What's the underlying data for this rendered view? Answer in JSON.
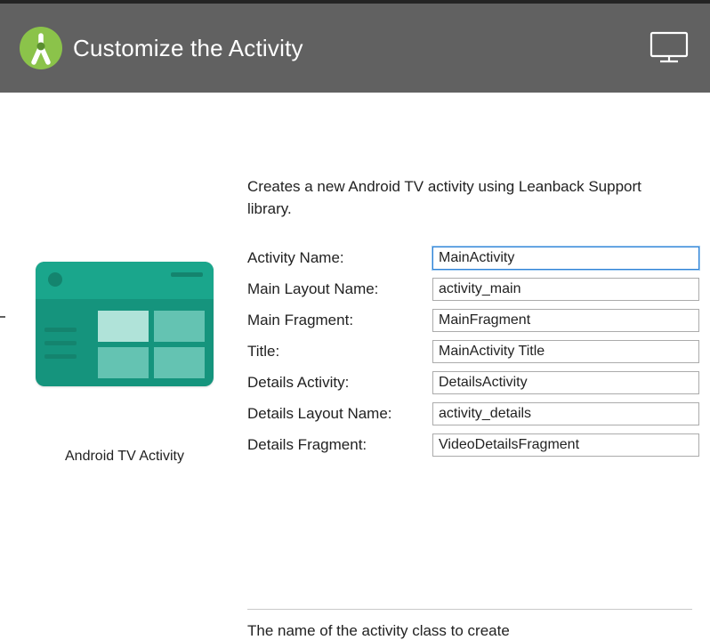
{
  "banner": {
    "title": "Customize the Activity"
  },
  "description": "Creates a new Android TV activity using Leanback Support library.",
  "preview": {
    "label": "Android TV Activity"
  },
  "fields": [
    {
      "id": "activity-name",
      "label": "Activity Name:",
      "value": "MainActivity",
      "focused": true
    },
    {
      "id": "main-layout-name",
      "label": "Main Layout Name:",
      "value": "activity_main",
      "focused": false
    },
    {
      "id": "main-fragment",
      "label": "Main Fragment:",
      "value": "MainFragment",
      "focused": false
    },
    {
      "id": "title",
      "label": "Title:",
      "value": "MainActivity Title",
      "focused": false
    },
    {
      "id": "details-activity",
      "label": "Details Activity:",
      "value": "DetailsActivity",
      "focused": false
    },
    {
      "id": "details-layout-name",
      "label": "Details Layout Name:",
      "value": "activity_details",
      "focused": false
    },
    {
      "id": "details-fragment",
      "label": "Details Fragment:",
      "value": "VideoDetailsFragment",
      "focused": false
    }
  ],
  "help": "The name of the activity class to create"
}
